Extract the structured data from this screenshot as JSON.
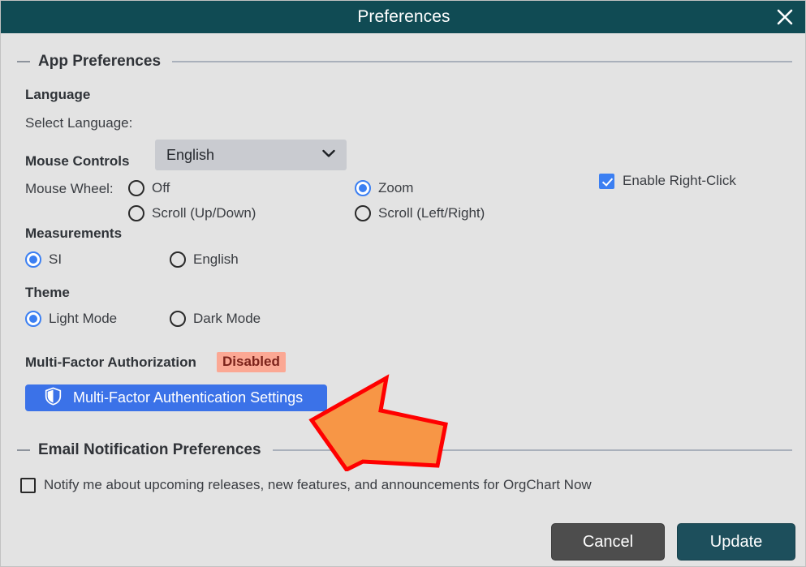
{
  "titlebar": {
    "title": "Preferences",
    "close_icon": "close-icon"
  },
  "app_preferences": {
    "section_title": "App Preferences",
    "language": {
      "group_label": "Language",
      "field_label": "Select Language:",
      "selected": "English",
      "chevron_icon": "chevron-down-icon"
    },
    "mouse_controls": {
      "group_label": "Mouse Controls",
      "field_label": "Mouse Wheel:",
      "options": [
        {
          "label": "Off",
          "checked": false
        },
        {
          "label": "Zoom",
          "checked": true
        },
        {
          "label": "Scroll (Up/Down)",
          "checked": false
        },
        {
          "label": "Scroll (Left/Right)",
          "checked": false
        }
      ],
      "right_click": {
        "label": "Enable Right-Click",
        "checked": true
      }
    },
    "measurements": {
      "group_label": "Measurements",
      "options": [
        {
          "label": "SI",
          "checked": true
        },
        {
          "label": "English",
          "checked": false
        }
      ]
    },
    "theme": {
      "group_label": "Theme",
      "options": [
        {
          "label": "Light Mode",
          "checked": true
        },
        {
          "label": "Dark Mode",
          "checked": false
        }
      ]
    },
    "mfa": {
      "title": "Multi-Factor Authorization",
      "status": "Disabled",
      "status_bg": "#fba894",
      "status_color": "#7c231b",
      "button_label": "Multi-Factor Authentication Settings",
      "button_icon": "shield-icon",
      "button_color": "#3b72e8"
    }
  },
  "email_preferences": {
    "section_title": "Email Notification Preferences",
    "notify": {
      "label": "Notify me about upcoming releases, new features, and announcements for OrgChart Now",
      "checked": false
    }
  },
  "footer": {
    "cancel_label": "Cancel",
    "update_label": "Update",
    "cancel_color": "#4d4d4d",
    "update_color": "#1d4f5c"
  },
  "overlay": {
    "arrow_icon": "arrow-left-callout-icon",
    "fill": "#F79646",
    "stroke": "#FF0000"
  },
  "colors": {
    "titlebar": "#104b54",
    "background": "#e3e3e3",
    "accent_blue": "#3b7ff2"
  }
}
